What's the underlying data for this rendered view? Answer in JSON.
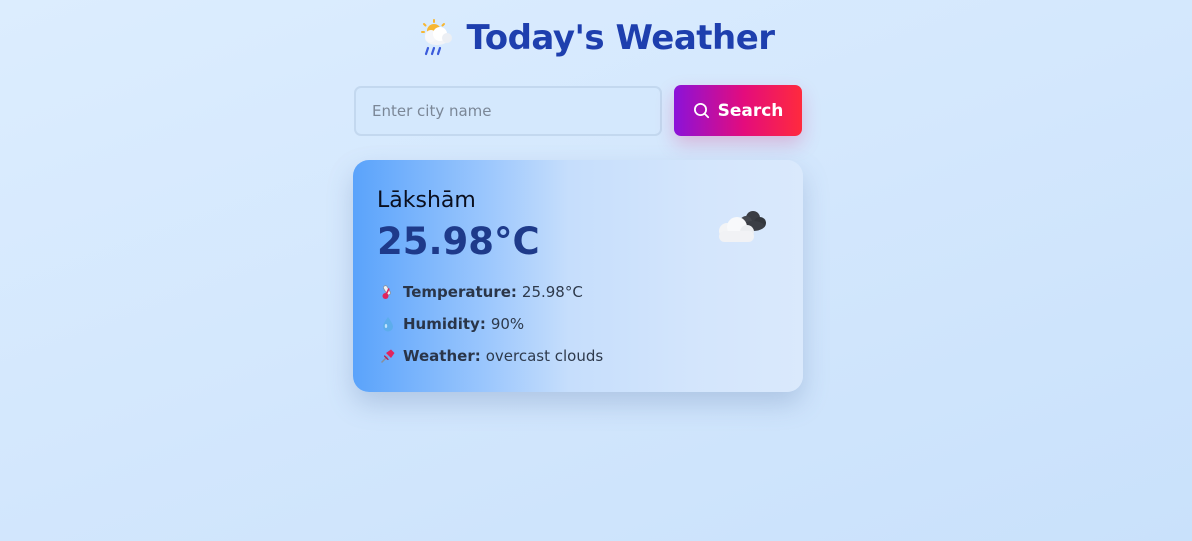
{
  "header": {
    "icon": "sun-behind-rain-cloud-icon",
    "title": "Today's Weather"
  },
  "search": {
    "placeholder": "Enter city name",
    "value": "",
    "button_label": "Search",
    "button_icon": "search-icon"
  },
  "weather": {
    "city": "Lākshām",
    "temperature_display": "25.98°C",
    "condition_icon": "cloud-icon",
    "details": [
      {
        "icon": "thermometer-icon",
        "label": "Temperature:",
        "value": "25.98°C"
      },
      {
        "icon": "droplet-icon",
        "label": "Humidity:",
        "value": "90%"
      },
      {
        "icon": "pushpin-icon",
        "label": "Weather:",
        "value": "overcast clouds"
      }
    ]
  },
  "colors": {
    "title": "#1e3fae",
    "temperature": "#1e3a8a",
    "button_gradient_start": "#8b12d9",
    "button_gradient_end": "#ff2a3d",
    "card_gradient_start": "#5aa3fb",
    "card_gradient_end": "#dae9fc"
  }
}
